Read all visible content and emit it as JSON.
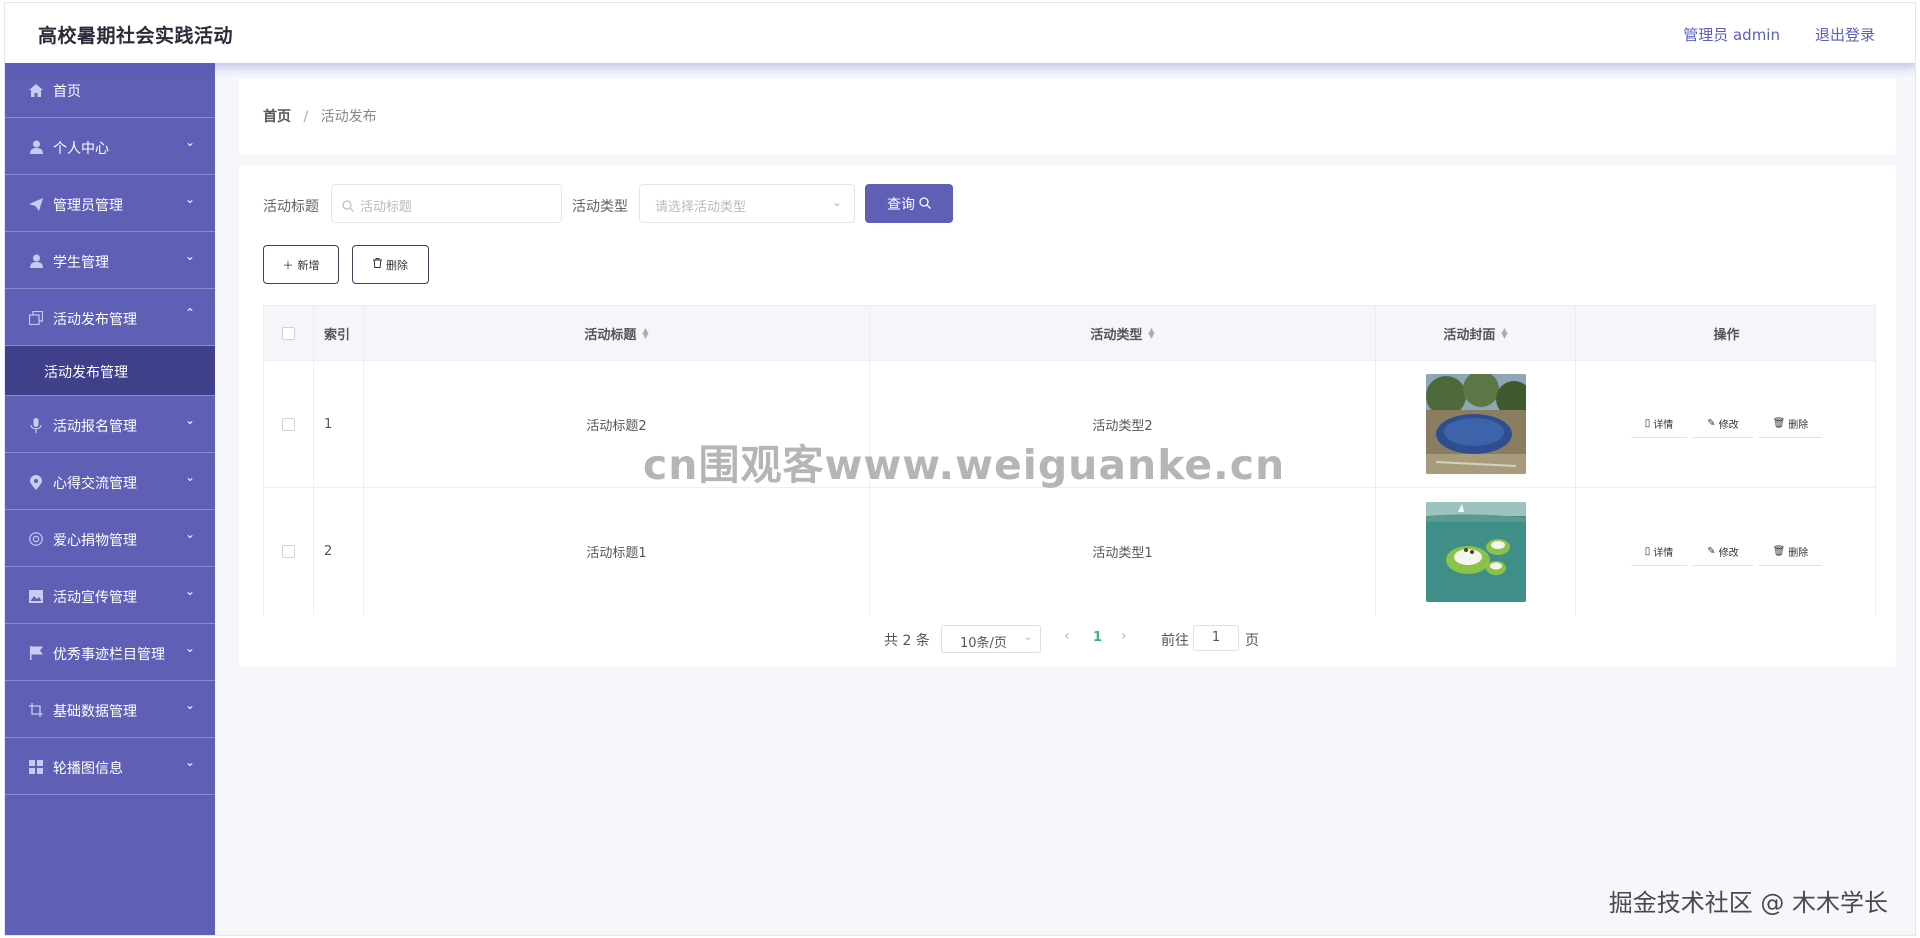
{
  "header": {
    "app_title": "高校暑期社会实践活动",
    "user_label": "管理员 admin",
    "logout_label": "退出登录"
  },
  "sidebar": {
    "items": [
      {
        "label": "首页",
        "icon": "home-icon",
        "caret": ""
      },
      {
        "label": "个人中心",
        "icon": "user-icon",
        "caret": "⌄"
      },
      {
        "label": "管理员管理",
        "icon": "send-icon",
        "caret": "⌄"
      },
      {
        "label": "学生管理",
        "icon": "user-icon",
        "caret": "⌄"
      },
      {
        "label": "活动发布管理",
        "icon": "copy-icon",
        "caret": "⌃",
        "expanded": true
      },
      {
        "label": "活动报名管理",
        "icon": "microphone-icon",
        "caret": "⌄"
      },
      {
        "label": "心得交流管理",
        "icon": "location-icon",
        "caret": "⌄"
      },
      {
        "label": "爱心捐物管理",
        "icon": "football-icon",
        "caret": "⌄"
      },
      {
        "label": "活动宣传管理",
        "icon": "picture-icon",
        "caret": "⌄"
      },
      {
        "label": "优秀事迹栏目管理",
        "icon": "flag-icon",
        "caret": "⌄"
      },
      {
        "label": "基础数据管理",
        "icon": "crop-icon",
        "caret": "⌄"
      },
      {
        "label": "轮播图信息",
        "icon": "menu-grid-icon",
        "caret": "⌄"
      }
    ],
    "submenu_active": "活动发布管理"
  },
  "breadcrumb": {
    "home": "首页",
    "separator": "/",
    "current": "活动发布"
  },
  "search": {
    "title_label": "活动标题",
    "title_placeholder": "活动标题",
    "type_label": "活动类型",
    "type_placeholder": "请选择活动类型",
    "query_label": "查询"
  },
  "actions": {
    "add_label": "新增",
    "delete_label": "删除"
  },
  "table": {
    "columns": [
      "索引",
      "活动标题",
      "活动类型",
      "活动封面",
      "操作"
    ],
    "rows": [
      {
        "index": "1",
        "title": "活动标题2",
        "type": "活动类型2",
        "cover": "outdoor-pool-photo"
      },
      {
        "index": "2",
        "title": "活动标题1",
        "type": "活动类型1",
        "cover": "water-trampoline-photo"
      }
    ],
    "row_actions": {
      "detail": "详情",
      "edit": "修改",
      "delete": "删除"
    }
  },
  "pagination": {
    "total": "共 2 条",
    "page_size": "10条/页",
    "current_page": "1",
    "goto_label": "前往",
    "goto_value": "1",
    "page_suffix": "页"
  },
  "watermarks": {
    "center": "cn围观客www.weiguanke.cn",
    "corner": "掘金技术社区 @ 木木学长"
  },
  "colors": {
    "accent": "#5e5fb5",
    "sidebar_active": "#3f3f8a",
    "page_active": "#3fb47a"
  }
}
